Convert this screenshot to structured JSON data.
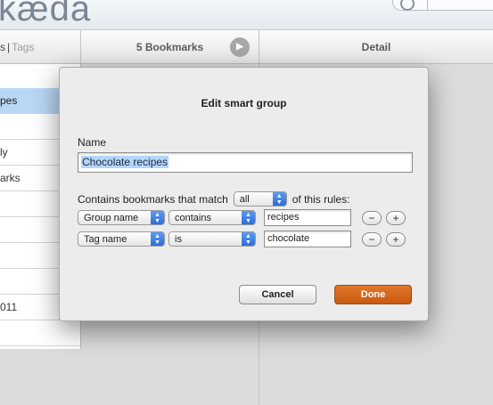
{
  "app": {
    "title": "kæda"
  },
  "columns": {
    "left": {
      "tab_a": "s",
      "separator": "|",
      "tab_b": "Tags"
    },
    "middle": {
      "label": "5 Bookmarks"
    },
    "right": {
      "label": "Detail"
    }
  },
  "groups": [
    "",
    "pes",
    "",
    "ly",
    "arks",
    "",
    "",
    "",
    "",
    "011",
    ""
  ],
  "dialog": {
    "title": "Edit smart group",
    "name_label": "Name",
    "name_value": "Chocolate recipes",
    "match_prefix": "Contains bookmarks that match",
    "match_value": "all",
    "match_suffix": "of this rules:",
    "rules": [
      {
        "field": "Group name",
        "operator": "contains",
        "value": "recipes"
      },
      {
        "field": "Tag name",
        "operator": "is",
        "value": "chocolate"
      }
    ],
    "minus_label": "−",
    "plus_label": "+",
    "cancel_label": "Cancel",
    "done_label": "Done"
  },
  "colors": {
    "accent": "#d2661a",
    "selection": "#b9d8f5"
  }
}
